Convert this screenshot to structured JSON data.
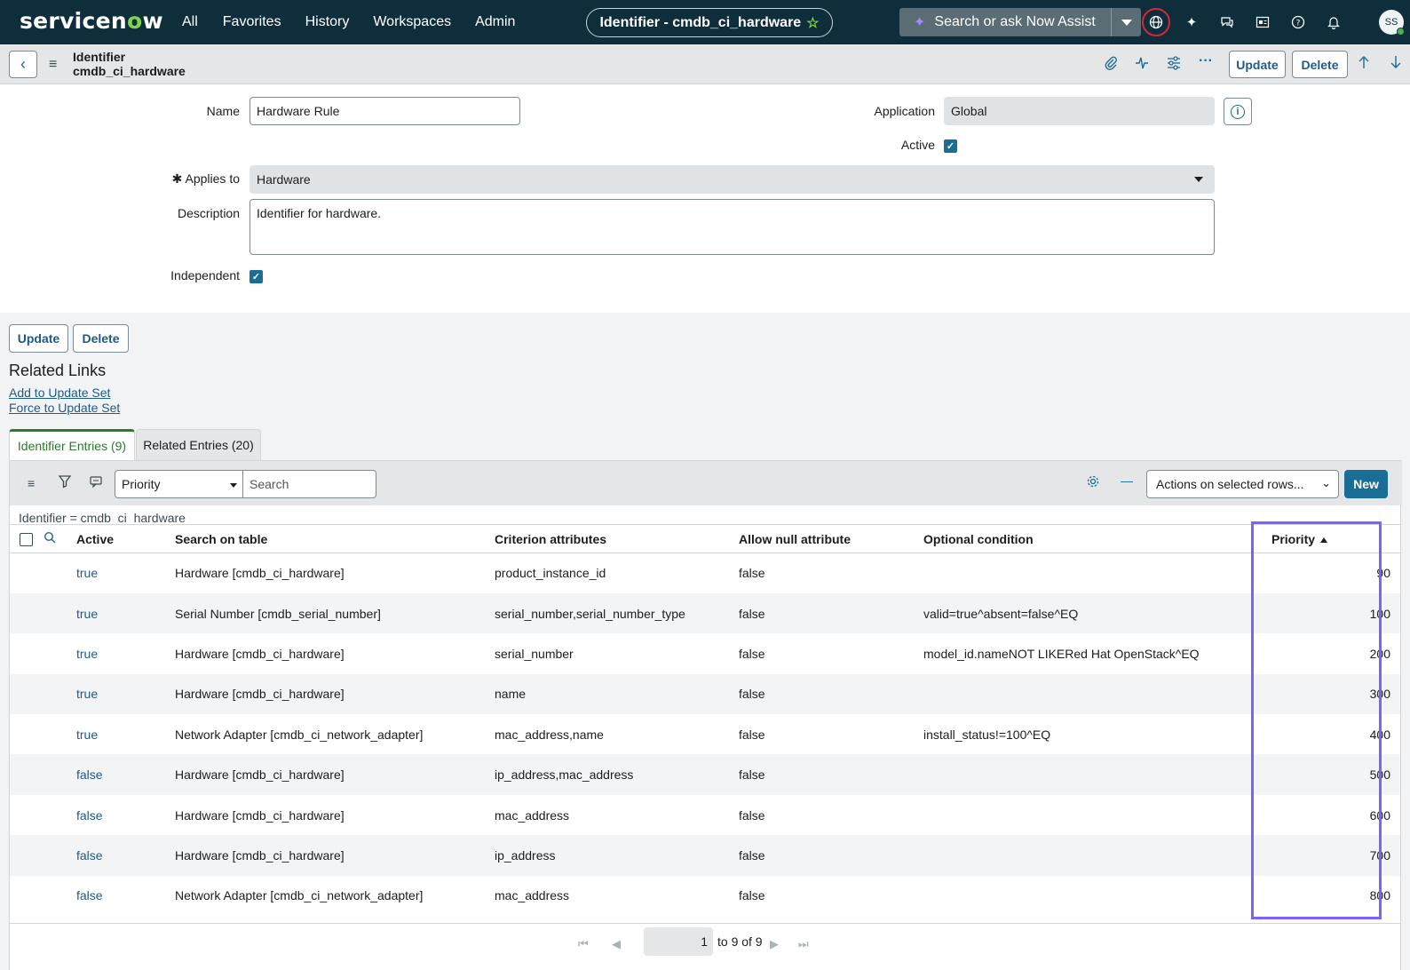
{
  "nav": {
    "logo_main": "servicen",
    "logo_ow": "o",
    "logo_end": "w",
    "menu": [
      "All",
      "Favorites",
      "History",
      "Workspaces",
      "Admin"
    ],
    "context_title": "Identifier - cmdb_ci_hardware",
    "assist_placeholder": "Search or ask Now Assist",
    "avatar_initials": "SS"
  },
  "form_header": {
    "title_line1": "Identifier",
    "title_line2": "cmdb_ci_hardware",
    "update_label": "Update",
    "delete_label": "Delete"
  },
  "form": {
    "name_label": "Name",
    "name_value": "Hardware Rule",
    "application_label": "Application",
    "application_value": "Global",
    "active_label": "Active",
    "active_checked": true,
    "applies_to_label": "Applies to",
    "applies_to_value": "Hardware",
    "description_label": "Description",
    "description_value": "Identifier for hardware.",
    "independent_label": "Independent",
    "independent_checked": true
  },
  "footer_buttons": {
    "update_label": "Update",
    "delete_label": "Delete"
  },
  "related_links": {
    "title": "Related Links",
    "links": [
      "Add to Update Set",
      "Force to Update Set"
    ]
  },
  "tabs": [
    {
      "label": "Identifier Entries (9)",
      "active": true
    },
    {
      "label": "Related Entries (20)",
      "active": false
    }
  ],
  "list": {
    "filter_field": "Priority",
    "search_placeholder": "Search",
    "actions_label": "Actions on selected rows...",
    "new_label": "New",
    "breadcrumb": "Identifier = cmdb_ci_hardware",
    "columns": [
      "Active",
      "Search on table",
      "Criterion attributes",
      "Allow null attribute",
      "Optional condition",
      "Priority"
    ],
    "rows": [
      {
        "active": "true",
        "table": "Hardware [cmdb_ci_hardware]",
        "criterion": "product_instance_id",
        "allow_null": "false",
        "condition": "",
        "priority": "90"
      },
      {
        "active": "true",
        "table": "Serial Number [cmdb_serial_number]",
        "criterion": "serial_number,serial_number_type",
        "allow_null": "false",
        "condition": "valid=true^absent=false^EQ",
        "priority": "100"
      },
      {
        "active": "true",
        "table": "Hardware [cmdb_ci_hardware]",
        "criterion": "serial_number",
        "allow_null": "false",
        "condition": "model_id.nameNOT LIKERed Hat OpenStack^EQ",
        "priority": "200"
      },
      {
        "active": "true",
        "table": "Hardware [cmdb_ci_hardware]",
        "criterion": "name",
        "allow_null": "false",
        "condition": "",
        "priority": "300"
      },
      {
        "active": "true",
        "table": "Network Adapter [cmdb_ci_network_adapter]",
        "criterion": "mac_address,name",
        "allow_null": "false",
        "condition": "install_status!=100^EQ",
        "priority": "400"
      },
      {
        "active": "false",
        "table": "Hardware [cmdb_ci_hardware]",
        "criterion": "ip_address,mac_address",
        "allow_null": "false",
        "condition": "",
        "priority": "500"
      },
      {
        "active": "false",
        "table": "Hardware [cmdb_ci_hardware]",
        "criterion": "mac_address",
        "allow_null": "false",
        "condition": "",
        "priority": "600"
      },
      {
        "active": "false",
        "table": "Hardware [cmdb_ci_hardware]",
        "criterion": "ip_address",
        "allow_null": "false",
        "condition": "",
        "priority": "700"
      },
      {
        "active": "false",
        "table": "Network Adapter [cmdb_ci_network_adapter]",
        "criterion": "mac_address",
        "allow_null": "false",
        "condition": "",
        "priority": "800"
      }
    ],
    "pager": {
      "current": "1",
      "range_text": "to 9 of 9"
    }
  },
  "colors": {
    "nav_bg": "#0f2e3c",
    "accent": "#1a6d95",
    "brand_green": "#81d44f",
    "highlight": "#7b61ff"
  },
  "icons": [
    "globe-icon",
    "sparkle-icon",
    "chat-icon",
    "news-icon",
    "help-icon",
    "bell-icon",
    "paperclip-icon",
    "activity-icon",
    "sliders-icon",
    "more-icon",
    "arrow-up-icon",
    "arrow-down-icon",
    "filter-icon",
    "gear-icon",
    "minus-icon"
  ]
}
